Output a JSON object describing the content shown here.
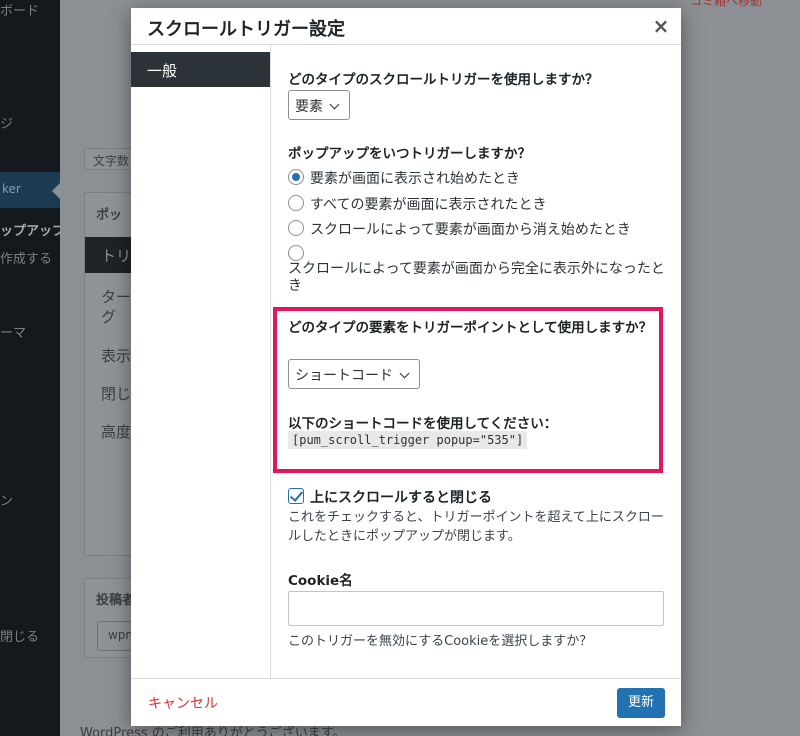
{
  "background": {
    "sidebar_items": [
      "ボード",
      "ジ",
      "ker",
      "ップアップ",
      "作成する",
      "ーマ",
      "ン",
      "閉じる"
    ],
    "content": {
      "top_right_link": "コミ箱へ移動",
      "char_count": "文字数",
      "popup_box_title": "ポッ",
      "popup_tabs": [
        "トリ",
        "ター\nグ",
        "表示",
        "閉じ",
        "高度"
      ],
      "author_box_title": "投稿者",
      "author_value": "wpn",
      "footer": "WordPress のご利用ありがとうございます。"
    }
  },
  "modal": {
    "title": "スクロールトリガー設定",
    "close_glyph": "×",
    "tabs": [
      {
        "label": "一般",
        "active": true
      }
    ],
    "body": {
      "q1_label": "どのタイプのスクロールトリガーを使用しますか？",
      "q1_select": "要素",
      "q2_label": "ポップアップをいつトリガーしますか？",
      "q2_options": [
        {
          "label": "要素が画面に表示され始めたとき",
          "checked": true
        },
        {
          "label": "すべての要素が画面に表示されたとき",
          "checked": false
        },
        {
          "label": "スクロールによって要素が画面から消え始めたとき",
          "checked": false
        },
        {
          "label": "スクロールによって要素が画面から完全に表示外になったとき",
          "checked": false
        }
      ],
      "q3_label": "どのタイプの要素をトリガーポイントとして使用しますか？",
      "q3_select": "ショートコード",
      "shortcode_label": "以下のショートコードを使用してください：",
      "shortcode": "[pum_scroll_trigger popup=\"535\"]",
      "close_on_scroll_label": "上にスクロールすると閉じる",
      "close_on_scroll_checked": true,
      "close_on_scroll_desc": "これをチェックすると、トリガーポイントを超えて上にスクロールしたときにポップアップが閉じます。",
      "cookie_label": "Cookie名",
      "cookie_value": "",
      "cookie_desc": "このトリガーを無効にするCookieを選択しますか？"
    },
    "footer": {
      "cancel_label": "キャンセル",
      "update_label": "更新"
    }
  },
  "colors": {
    "primary": "#2271b1",
    "danger": "#d63638",
    "highlight": "#e3165b",
    "overlay": "#8c8f94"
  }
}
